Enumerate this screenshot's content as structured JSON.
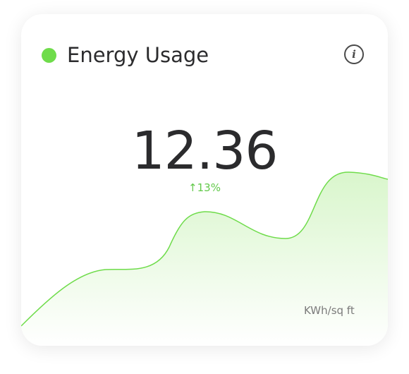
{
  "widget": {
    "title": "Energy Usage",
    "value": "12.36",
    "change_arrow": "↑",
    "change_percent": "13%",
    "unit_label": "KWh/sq ft",
    "info_icon_glyph": "i",
    "status_icon": "green-dot-icon"
  },
  "colors": {
    "accent": "#6fdc4b",
    "trend_text": "#62c94a",
    "area_fill_top": "#d9f6cc",
    "area_fill_bottom": "#ffffff",
    "title_text": "#2c2c2e",
    "value_text": "#2b2b2d"
  }
}
